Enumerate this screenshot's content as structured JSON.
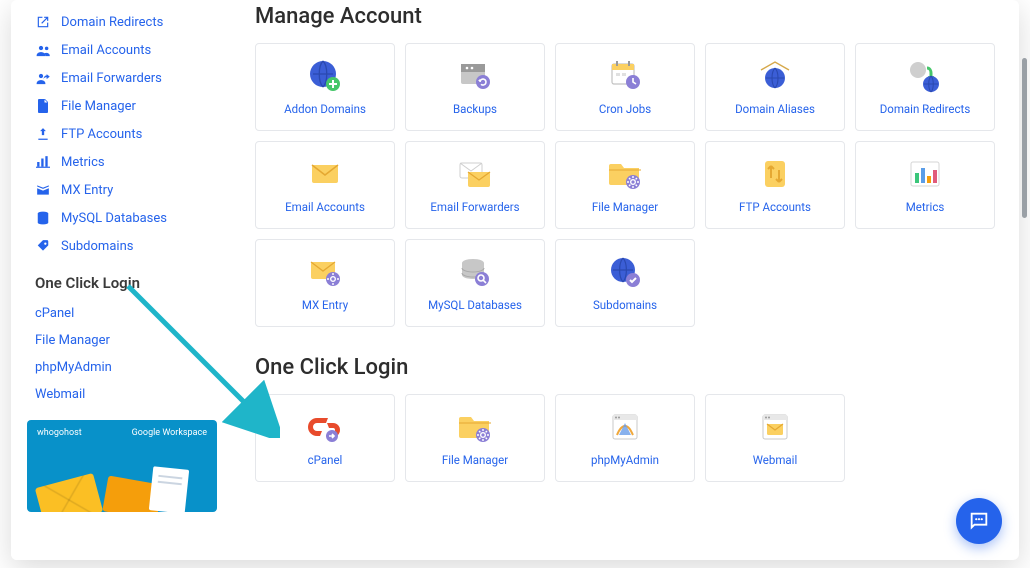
{
  "sidebar": {
    "items": [
      {
        "label": "Domain Redirects",
        "icon": "external-link-icon"
      },
      {
        "label": "Email Accounts",
        "icon": "users-icon"
      },
      {
        "label": "Email Forwarders",
        "icon": "users-share-icon"
      },
      {
        "label": "File Manager",
        "icon": "file-icon"
      },
      {
        "label": "FTP Accounts",
        "icon": "upload-icon"
      },
      {
        "label": "Metrics",
        "icon": "bar-chart-icon"
      },
      {
        "label": "MX Entry",
        "icon": "mx-icon"
      },
      {
        "label": "MySQL Databases",
        "icon": "database-icon"
      },
      {
        "label": "Subdomains",
        "icon": "tag-icon"
      }
    ],
    "login_heading": "One Click Login",
    "login_items": [
      {
        "label": "cPanel"
      },
      {
        "label": "File Manager"
      },
      {
        "label": "phpMyAdmin"
      },
      {
        "label": "Webmail"
      }
    ],
    "promo": {
      "brand_left": "whogohost",
      "brand_right": "Google Workspace"
    }
  },
  "sections": {
    "manage_account": {
      "title": "Manage Account",
      "cards": [
        {
          "label": "Addon Domains"
        },
        {
          "label": "Backups"
        },
        {
          "label": "Cron Jobs"
        },
        {
          "label": "Domain Aliases"
        },
        {
          "label": "Domain Redirects"
        },
        {
          "label": "Email Accounts"
        },
        {
          "label": "Email Forwarders"
        },
        {
          "label": "File Manager"
        },
        {
          "label": "FTP Accounts"
        },
        {
          "label": "Metrics"
        },
        {
          "label": "MX Entry"
        },
        {
          "label": "MySQL Databases"
        },
        {
          "label": "Subdomains"
        }
      ]
    },
    "one_click_login": {
      "title": "One Click Login",
      "cards": [
        {
          "label": "cPanel"
        },
        {
          "label": "File Manager"
        },
        {
          "label": "phpMyAdmin"
        },
        {
          "label": "Webmail"
        }
      ]
    }
  },
  "colors": {
    "link": "#2563eb",
    "accent_yellow": "#fbbf24",
    "accent_orange": "#f59e0b",
    "globe_blue": "#3b5ed6",
    "purple": "#8b7fd6",
    "promo_bg": "#0891c9",
    "arrow": "#1fb5c9"
  }
}
